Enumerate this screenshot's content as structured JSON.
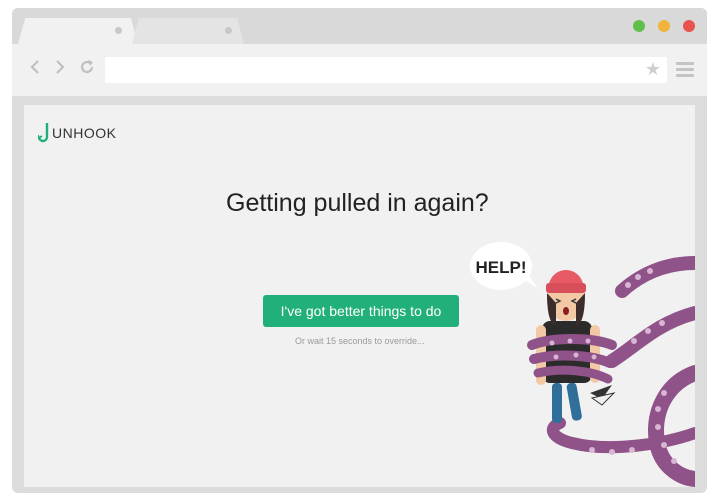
{
  "browser": {
    "window_controls": [
      "minimize",
      "maximize",
      "close"
    ],
    "control_colors": {
      "minimize": "#5fbf4a",
      "maximize": "#f0b43c",
      "close": "#e8534b"
    },
    "address_value": "",
    "icons": [
      "back-icon",
      "forward-icon",
      "reload-icon",
      "bookmark-star-icon",
      "menu-icon"
    ]
  },
  "page": {
    "logo_text": "UNHOOK",
    "headline": "Getting pulled in again?",
    "cta_label": "I've got better things to do",
    "wait_text": "Or wait 15 seconds to override...",
    "speech_bubble": "HELP!",
    "accent_color": "#22b07a",
    "tentacle_color": "#8f5289"
  }
}
